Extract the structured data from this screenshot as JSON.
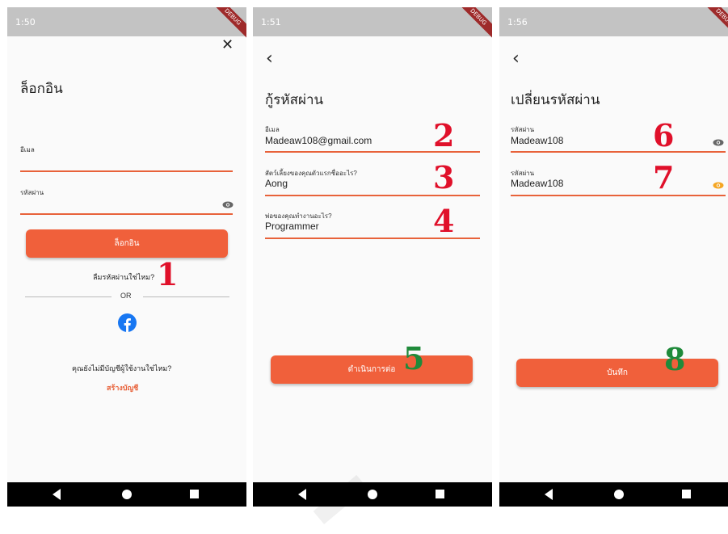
{
  "screens": [
    {
      "status_time": "1:50",
      "debug": "DEBUG",
      "title": "ล็อกอิน",
      "close_icon": "✕",
      "email_label": "อีเมล",
      "password_label": "รหัสผ่าน",
      "login_button": "ล็อกอิน",
      "forgot_link": "ลืมรหัสผ่านใช่ไหม?",
      "or_text": "OR",
      "no_account_text": "คุณยังไม่มีบัญชีผู้ใช้งานใช่ไหม?",
      "signup_link": "สร้างบัญชี",
      "markers": [
        "1"
      ]
    },
    {
      "status_time": "1:51",
      "debug": "DEBUG",
      "title": "กู้รหัสผ่าน",
      "fields": [
        {
          "label": "อีเมล",
          "value": "Madeaw108@gmail.com"
        },
        {
          "label": "สัตว์เลี้ยงของคุณตัวแรกชื่ออะไร?",
          "value": "Aong"
        },
        {
          "label": "พ่อของคุณทำงานอะไร?",
          "value": "Programmer"
        }
      ],
      "continue_button": "ดำเนินการต่อ",
      "markers": [
        "2",
        "3",
        "4",
        "5"
      ]
    },
    {
      "status_time": "1:56",
      "debug": "DEBUG",
      "title": "เปลี่ยนรหัสผ่าน",
      "fields": [
        {
          "label": "รหัสผ่าน",
          "value": "Madeaw108"
        },
        {
          "label": "รหัสผ่าน",
          "value": "Madeaw108"
        }
      ],
      "save_button": "บันทึก",
      "markers": [
        "6",
        "7",
        "8"
      ]
    }
  ],
  "colors": {
    "accent": "#f0603b",
    "underline": "#e8623a",
    "marker_red": "#e0102a",
    "marker_green": "#1f8a3a",
    "facebook": "#1877f2"
  },
  "icons": [
    "close-icon",
    "back-arrow-icon",
    "eye-icon",
    "facebook-icon",
    "wifi-icon",
    "battery-icon"
  ]
}
